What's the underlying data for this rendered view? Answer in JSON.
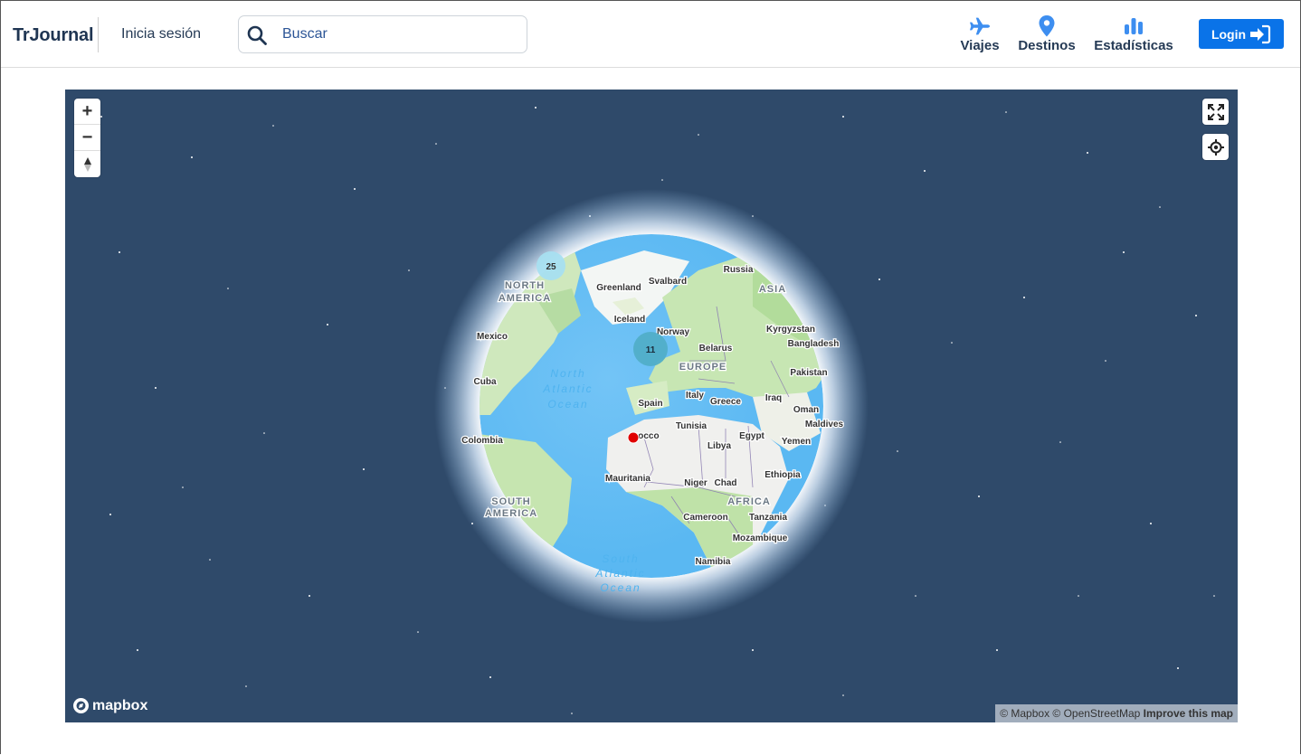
{
  "navbar": {
    "brand": "TrJournal",
    "signin_label": "Inicia sesión",
    "search_placeholder": "Buscar",
    "links": [
      {
        "label": "Viajes",
        "icon": "plane-icon"
      },
      {
        "label": "Destinos",
        "icon": "map-pin-icon"
      },
      {
        "label": "Estadísticas",
        "icon": "bar-chart-icon"
      }
    ],
    "login_label": "Login",
    "login_icon": "sign-in-icon",
    "accent_color": "#0a73e8",
    "link_icon_color": "#3d8ef0"
  },
  "map": {
    "background_color": "#2f4a6a",
    "controls": {
      "zoom_in": "+",
      "zoom_out": "−"
    },
    "clusters": [
      {
        "count": "25"
      },
      {
        "count": "11"
      }
    ],
    "marker_color": "#e00000",
    "labels": {
      "countries": [
        "Russia",
        "Svalbard",
        "Greenland",
        "Iceland",
        "Norway",
        "Belarus",
        "Kyrgyzstan",
        "Bangladesh",
        "Mexico",
        "Pakistan",
        "Cuba",
        "Spain",
        "Italy",
        "Greece",
        "Iraq",
        "Oman",
        "Maldives",
        "Tunisia",
        "Colombia",
        "rocco",
        "Egypt",
        "Libya",
        "Yemen",
        "Mauritania",
        "Ethiopia",
        "Niger",
        "Chad",
        "Cameroon",
        "Tanzania",
        "Mozambique",
        "Namibia"
      ],
      "continents": [
        "NORTH",
        "AMERICA",
        "ASIA",
        "EUROPE",
        "AFRICA",
        "SOUTH",
        "AMERICA"
      ],
      "oceans": [
        "North",
        "Atlantic",
        "Ocean",
        "South",
        "Atlantic",
        "Ocean"
      ]
    },
    "logo_text": "mapbox",
    "attribution": "© Mapbox © OpenStreetMap",
    "improve_link": "Improve this map"
  }
}
